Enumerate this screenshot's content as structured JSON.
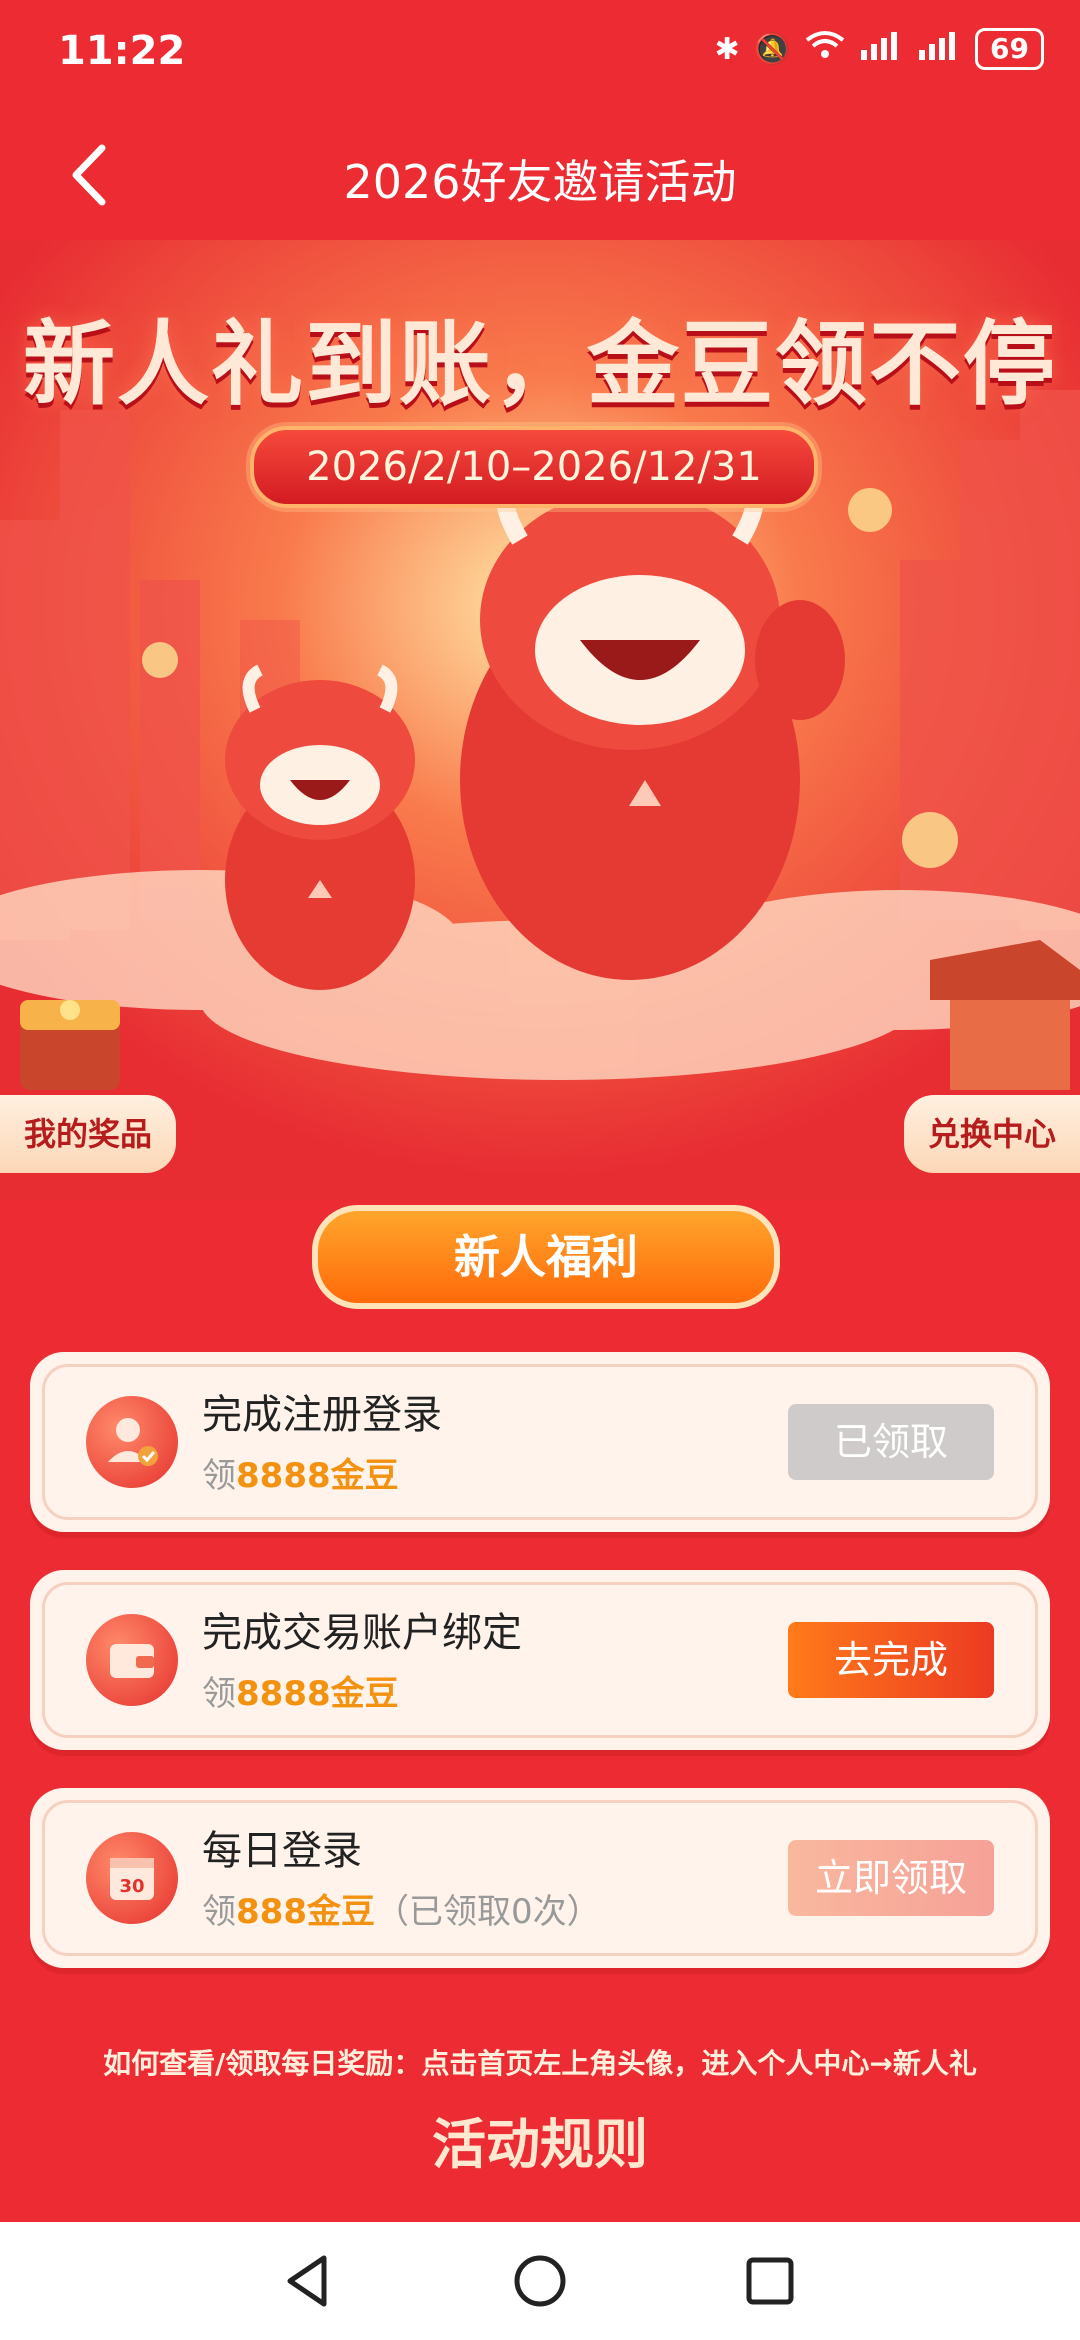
{
  "status_bar": {
    "time": "11:22",
    "battery": "69"
  },
  "app_bar": {
    "title": "2026好友邀请活动"
  },
  "hero": {
    "headline": "新人礼到账，金豆领不停",
    "date_range": "2026/2/10–2026/12/31",
    "prizes_button": "我的奖品",
    "exchange_button": "兑换中心"
  },
  "section": {
    "title": "新人福利"
  },
  "tasks": [
    {
      "title": "完成注册登录",
      "reward_prefix": "领",
      "reward_value": "8888金豆",
      "reward_suffix": "",
      "button": "已领取",
      "icon": "user-check-icon"
    },
    {
      "title": "完成交易账户绑定",
      "reward_prefix": "领",
      "reward_value": "8888金豆",
      "reward_suffix": "",
      "button": "去完成",
      "icon": "wallet-icon"
    },
    {
      "title": "每日登录",
      "reward_prefix": "领",
      "reward_value": "888金豆",
      "reward_suffix": "（已领取0次）",
      "button": "立即领取",
      "icon": "calendar-icon",
      "icon_text": "30"
    }
  ],
  "hint": "如何查看/领取每日奖励：点击首页左上角头像，进入个人中心→新人礼",
  "rules": {
    "title": "活动规则"
  },
  "colors": {
    "background": "#EC2B33",
    "accent_orange": "#F39210",
    "button_orange": "#FF6A0A"
  }
}
